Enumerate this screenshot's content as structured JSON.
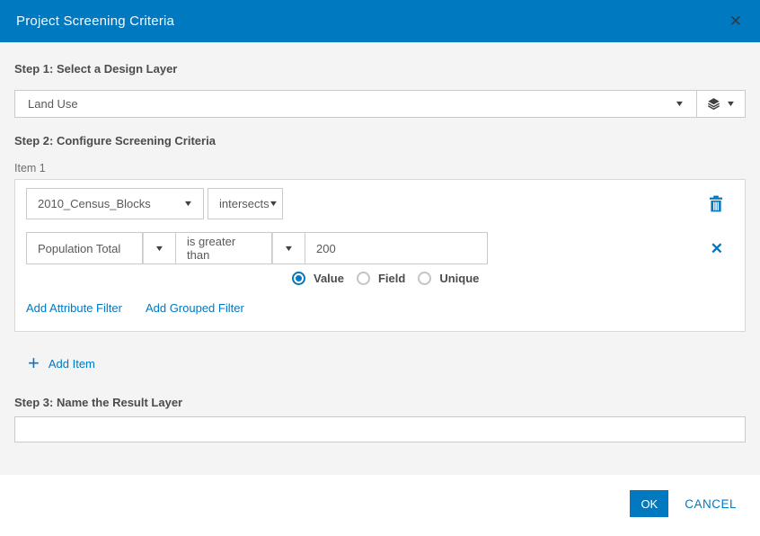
{
  "dialog": {
    "title": "Project Screening Criteria"
  },
  "step1": {
    "label": "Step 1: Select a Design Layer",
    "layer_select": {
      "value": "Land Use"
    }
  },
  "step2": {
    "label": "Step 2: Configure Screening Criteria",
    "items": [
      {
        "label": "Item 1",
        "spatial": {
          "layer": "2010_Census_Blocks",
          "operator": "intersects"
        },
        "attribute_filter": {
          "field": "Population Total",
          "operator": "is greater than",
          "value": "200",
          "modes": [
            {
              "label": "Value",
              "selected": true
            },
            {
              "label": "Field",
              "selected": false
            },
            {
              "label": "Unique",
              "selected": false
            }
          ]
        },
        "links": {
          "add_attribute_filter": "Add Attribute Filter",
          "add_grouped_filter": "Add Grouped Filter"
        }
      }
    ],
    "add_item_label": "Add Item"
  },
  "step3": {
    "label": "Step 3: Name the Result Layer",
    "input_value": ""
  },
  "footer": {
    "ok_label": "OK",
    "cancel_label": "CANCEL"
  },
  "colors": {
    "accent": "#0079c1",
    "header_bg": "#0079c1",
    "body_bg": "#f4f4f4"
  }
}
